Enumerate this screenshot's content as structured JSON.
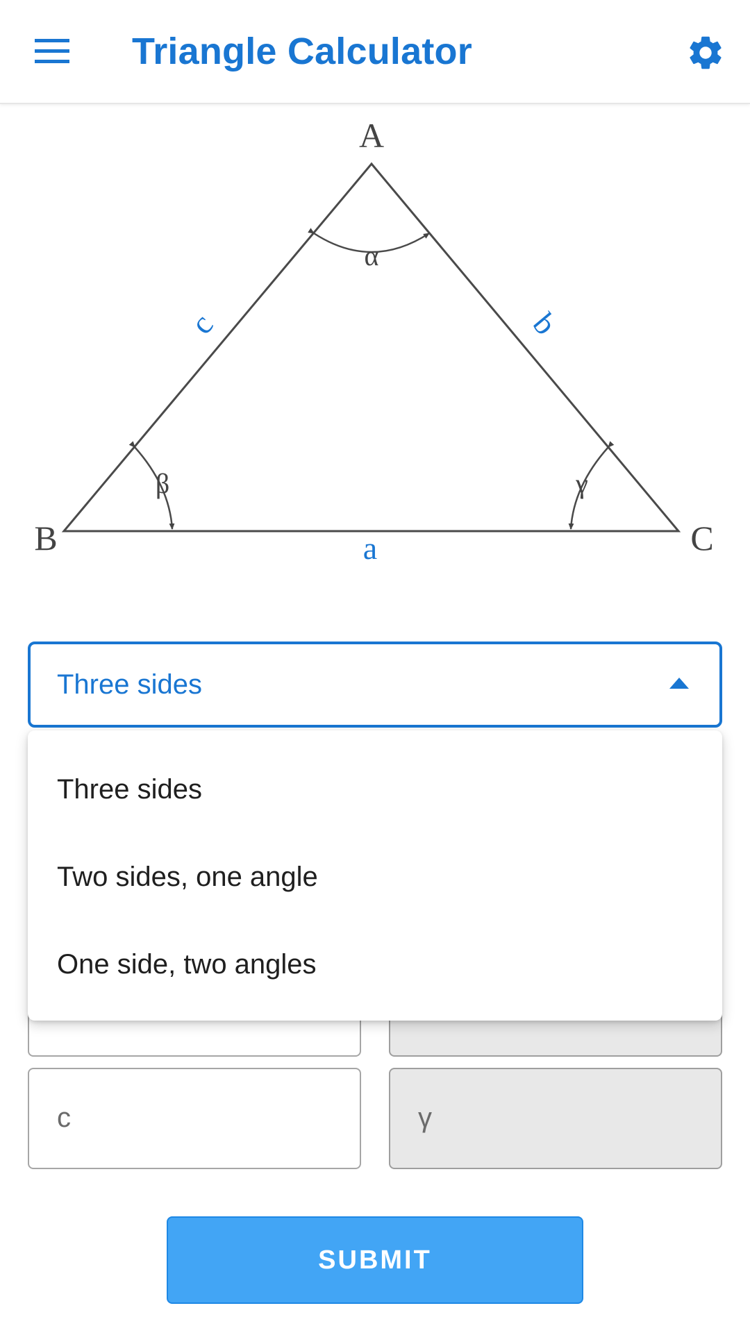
{
  "header": {
    "title": "Triangle Calculator",
    "menu_icon": "hamburger-menu-icon",
    "settings_icon": "gear-icon"
  },
  "diagram": {
    "vertices": {
      "A": "A",
      "B": "B",
      "C": "C"
    },
    "sides": {
      "a": "a",
      "b": "b",
      "c": "c"
    },
    "angles": {
      "alpha": "α",
      "beta": "β",
      "gamma": "γ"
    }
  },
  "mode_select": {
    "value": "Three sides",
    "options": [
      "Three sides",
      "Two sides, one angle",
      "One side, two angles"
    ]
  },
  "inputs": {
    "left_1": "",
    "right_1": "",
    "left_2": "c",
    "right_2": "γ"
  },
  "submit": {
    "label": "SUBMIT"
  },
  "colors": {
    "primary": "#1976d2",
    "button": "#42a5f5",
    "readonly_field": "#e8e8e8"
  }
}
